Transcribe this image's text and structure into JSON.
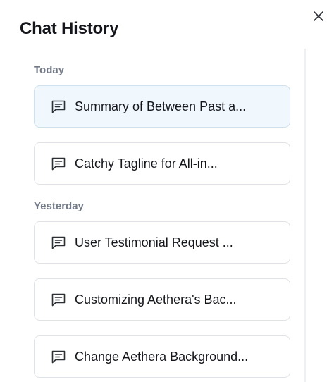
{
  "header": {
    "title": "Chat History"
  },
  "icons": {
    "close": "close-icon",
    "chat": "message-square-icon"
  },
  "colors": {
    "active_item_bg": "#f0f7fd",
    "item_border": "#dfe2e7",
    "section_label": "#727a88",
    "text": "#14161c"
  },
  "sections": [
    {
      "label": "Today",
      "items": [
        {
          "label": "Summary of Between Past a...",
          "active": true
        },
        {
          "label": "Catchy Tagline for All-in...",
          "active": false
        }
      ]
    },
    {
      "label": "Yesterday",
      "items": [
        {
          "label": "User Testimonial Request ...",
          "active": false
        },
        {
          "label": "Customizing Aethera's Bac...",
          "active": false
        },
        {
          "label": "Change Aethera Background...",
          "active": false
        }
      ]
    }
  ]
}
